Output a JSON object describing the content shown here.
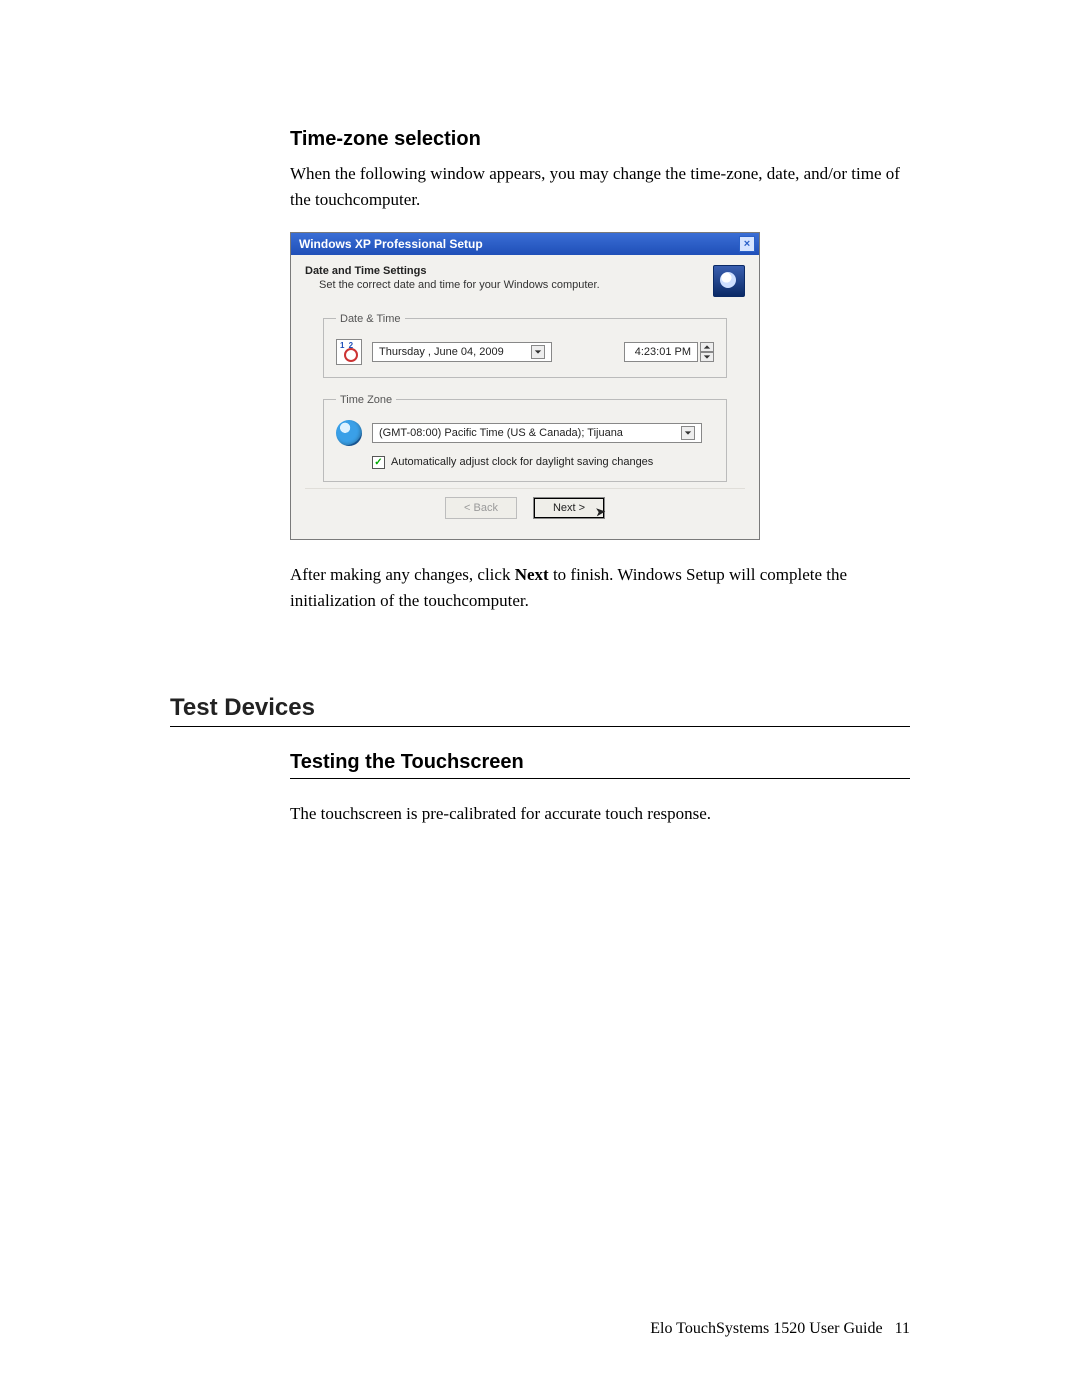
{
  "section1": {
    "heading": "Time-zone selection",
    "p1": "When the following window appears, you may change the time-zone, date, and/or time of the touchcomputer.",
    "p2a": "After making any changes, click ",
    "p2_bold": "Next",
    "p2b": " to finish. Windows Setup will complete the initialization of the touchcomputer."
  },
  "section2": {
    "heading": "Test Devices",
    "subheading": "Testing the Touchscreen",
    "p1": "The touchscreen is pre-calibrated for accurate touch response."
  },
  "dialog": {
    "title": "Windows XP Professional Setup",
    "close_x": "×",
    "head_bold": "Date and Time Settings",
    "head_sub": "Set the correct date and time for your Windows computer.",
    "group_date": "Date & Time",
    "date_value": "Thursday ,   June   04, 2009",
    "time_value": "4:23:01 PM",
    "group_tz": "Time Zone",
    "tz_value": "(GMT-08:00) Pacific Time (US & Canada); Tijuana",
    "dst_label": "Automatically adjust clock for daylight saving changes",
    "dst_checked": "✓",
    "btn_back": "< Back",
    "btn_next": "Next >"
  },
  "footer": {
    "product": "Elo TouchSystems  1520 User Guide",
    "page": "11"
  }
}
